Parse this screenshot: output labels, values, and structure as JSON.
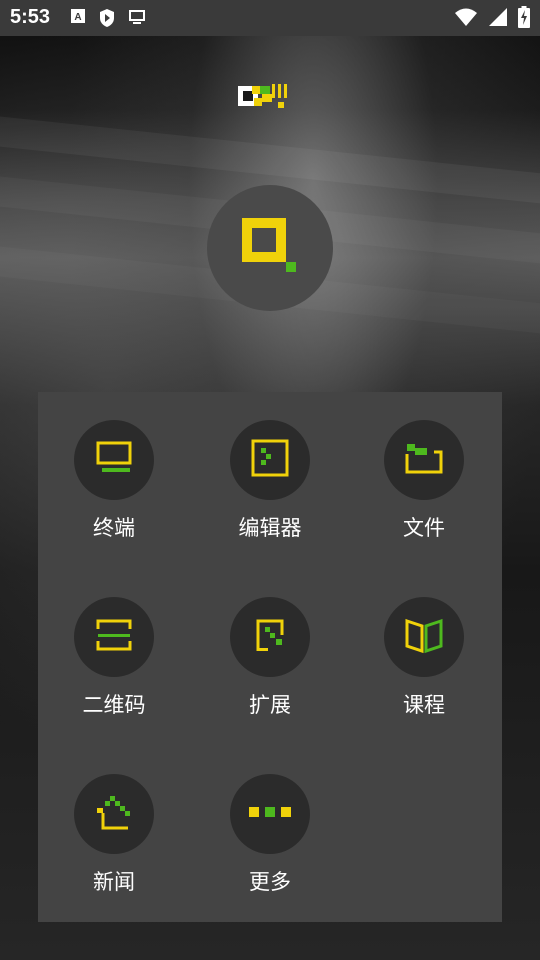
{
  "status_bar": {
    "time": "5:53",
    "left_icons": [
      "a-notification-icon",
      "shield-play-icon",
      "monitor-icon"
    ],
    "right_icons": [
      "wifi-icon",
      "cellular-signal-icon",
      "battery-charging-icon"
    ]
  },
  "header": {
    "logo_icon": "app-logo-icon",
    "avatar_icon": "user-avatar-icon"
  },
  "menu": {
    "items": [
      {
        "label": "终端",
        "icon": "terminal-icon"
      },
      {
        "label": "编辑器",
        "icon": "editor-icon"
      },
      {
        "label": "文件",
        "icon": "folder-icon"
      },
      {
        "label": "二维码",
        "icon": "qr-scan-icon"
      },
      {
        "label": "扩展",
        "icon": "extension-icon"
      },
      {
        "label": "课程",
        "icon": "book-icon"
      },
      {
        "label": "新闻",
        "icon": "news-icon"
      },
      {
        "label": "更多",
        "icon": "more-icon"
      }
    ]
  },
  "colors": {
    "accent_yellow": "#f0d20a",
    "accent_green": "#4eb91e",
    "panel": "#444444",
    "circle": "#2b2b2b"
  }
}
